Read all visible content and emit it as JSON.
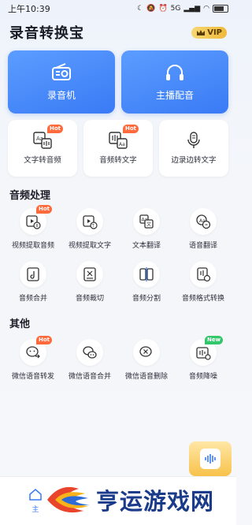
{
  "status_bar": {
    "time": "上午10:39",
    "signal": "5G"
  },
  "header": {
    "title": "录音转换宝",
    "vip_label": "VIP"
  },
  "hero": [
    {
      "label": "录音机",
      "icon": "radio-icon"
    },
    {
      "label": "主播配音",
      "icon": "headphones-icon"
    }
  ],
  "tools": [
    {
      "label": "文字转音频",
      "icon": "text-to-audio-icon",
      "badge": "Hot"
    },
    {
      "label": "音频转文字",
      "icon": "audio-to-text-icon",
      "badge": "Hot"
    },
    {
      "label": "边录边转文字",
      "icon": "microphone-icon",
      "badge": ""
    }
  ],
  "audio_section": {
    "title": "音频处理",
    "items": [
      {
        "label": "视频提取音频",
        "icon": "video-extract-audio-icon",
        "badge": "Hot"
      },
      {
        "label": "视频提取文字",
        "icon": "video-extract-text-icon",
        "badge": ""
      },
      {
        "label": "文本翻译",
        "icon": "text-translate-icon",
        "badge": ""
      },
      {
        "label": "语音翻译",
        "icon": "voice-translate-icon",
        "badge": ""
      },
      {
        "label": "音频合并",
        "icon": "audio-merge-icon",
        "badge": ""
      },
      {
        "label": "音频裁切",
        "icon": "audio-cut-icon",
        "badge": ""
      },
      {
        "label": "音频分割",
        "icon": "audio-split-icon",
        "badge": ""
      },
      {
        "label": "音频格式转换",
        "icon": "audio-format-icon",
        "badge": ""
      }
    ]
  },
  "other_section": {
    "title": "其他",
    "items": [
      {
        "label": "微信语音转发",
        "icon": "wechat-forward-icon",
        "badge": "Hot"
      },
      {
        "label": "微信语音合并",
        "icon": "wechat-merge-icon",
        "badge": ""
      },
      {
        "label": "微信语音删除",
        "icon": "wechat-delete-icon",
        "badge": ""
      },
      {
        "label": "音频降噪",
        "icon": "noise-reduction-icon",
        "badge": "New"
      }
    ]
  },
  "bottom_nav": {
    "home_label": "主"
  },
  "watermark": {
    "text": "亨运游戏网"
  },
  "colors": {
    "primary": "#3a7af5",
    "hot": "#ff6a3d",
    "new": "#34c66a",
    "vip": "#f0b93a"
  }
}
